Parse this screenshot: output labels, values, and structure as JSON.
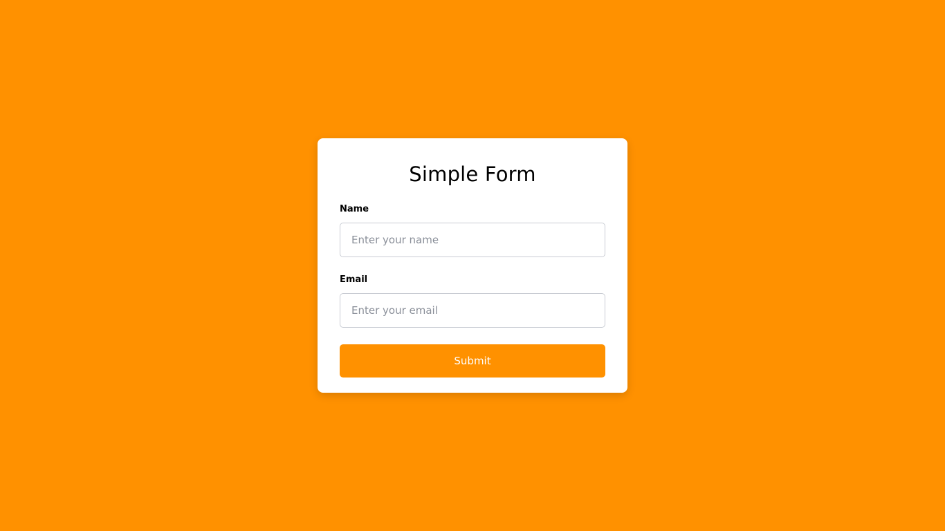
{
  "form": {
    "title": "Simple Form",
    "fields": [
      {
        "label": "Name",
        "placeholder": "Enter your name",
        "value": ""
      },
      {
        "label": "Email",
        "placeholder": "Enter your email",
        "value": ""
      }
    ],
    "submit_label": "Submit"
  },
  "colors": {
    "background": "#ff9100",
    "accent": "#ff9100",
    "card": "#ffffff"
  }
}
